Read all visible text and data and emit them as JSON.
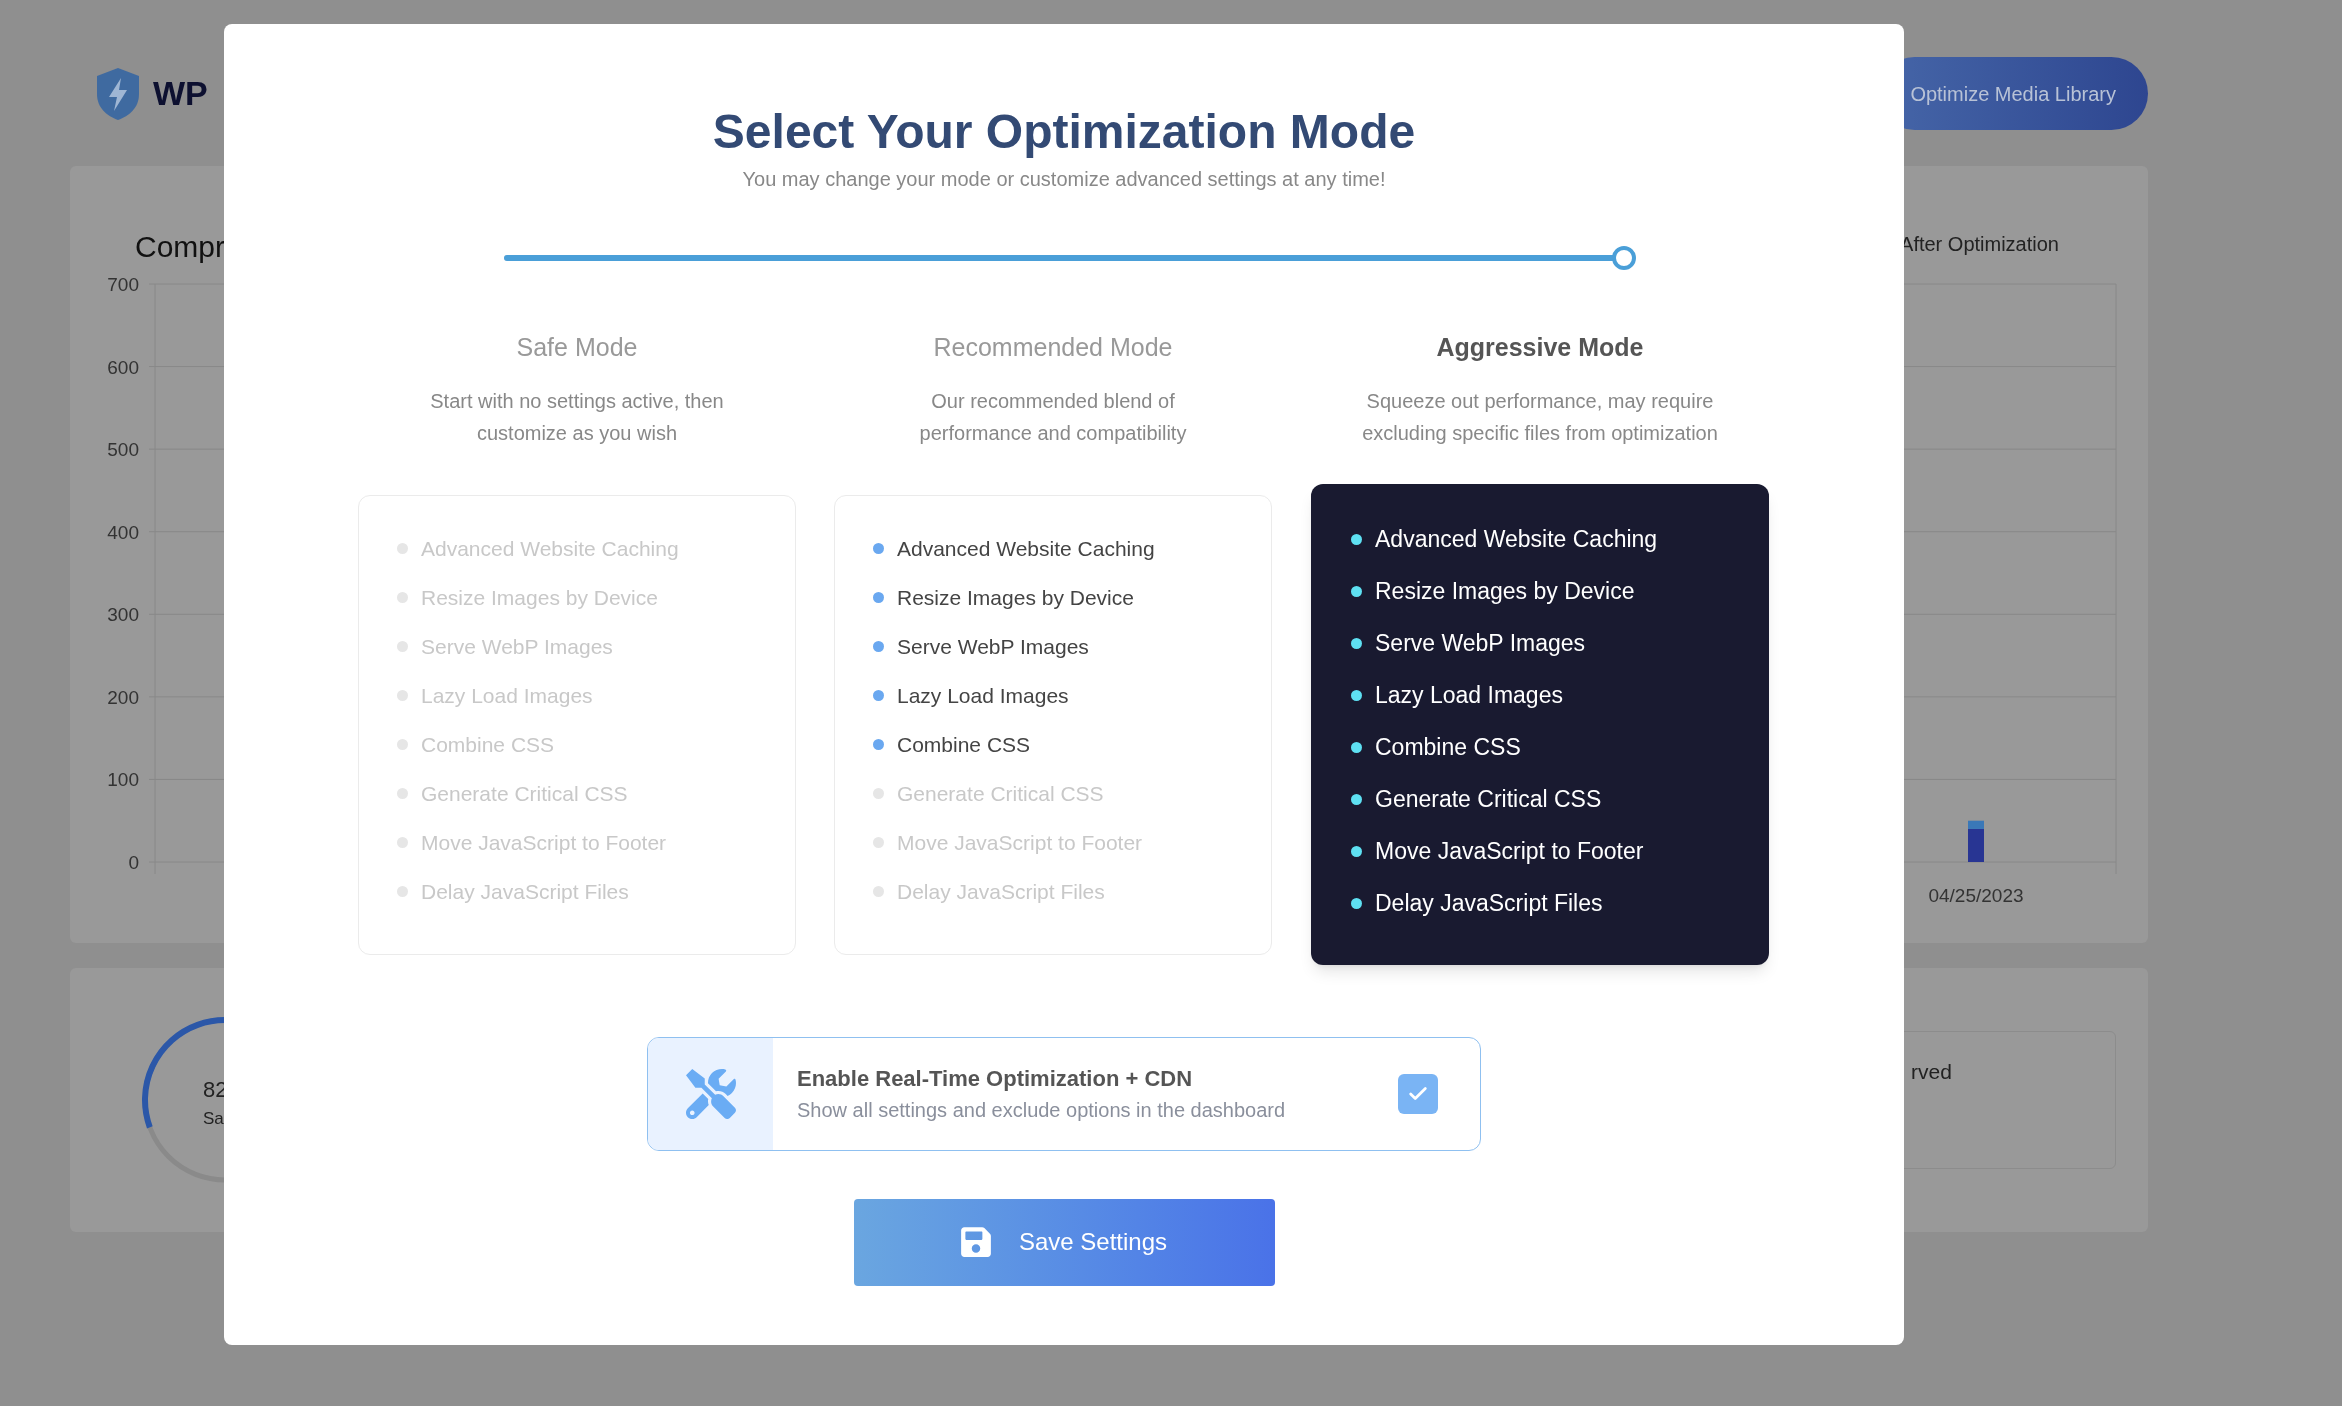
{
  "background": {
    "logo_text": "WP",
    "header_button": "Optimize Media Library",
    "chart_card": {
      "title": "Compr",
      "chart_data": {
        "type": "bar",
        "stacked": true,
        "grid": true,
        "categories": [
          "04/25/2023"
        ],
        "ylim": [
          0,
          700
        ],
        "yticks": [
          0,
          100,
          200,
          300,
          400,
          500,
          600,
          700
        ],
        "series": [
          {
            "name": "After Optimization",
            "color": "#283593",
            "values": [
              40
            ]
          },
          {
            "color": "#3a78b8",
            "values": [
              10
            ]
          }
        ]
      }
    },
    "stats_card": {
      "gauge_value": "82",
      "gauge_label": "Sa",
      "box_text": "rved"
    }
  },
  "modal": {
    "title": "Select Your Optimization Mode",
    "subtitle": "You may change your mode or customize advanced settings at any time!",
    "slider": {
      "level": 1
    },
    "modes": [
      {
        "name": "Safe Mode",
        "description": "Start with no settings active, then customize as you wish",
        "selected": false,
        "features": [
          {
            "label": "Advanced Website Caching",
            "enabled": false
          },
          {
            "label": "Resize Images by Device",
            "enabled": false
          },
          {
            "label": "Serve WebP Images",
            "enabled": false
          },
          {
            "label": "Lazy Load Images",
            "enabled": false
          },
          {
            "label": "Combine CSS",
            "enabled": false
          },
          {
            "label": "Generate Critical CSS",
            "enabled": false
          },
          {
            "label": "Move JavaScript to Footer",
            "enabled": false
          },
          {
            "label": "Delay JavaScript Files",
            "enabled": false
          }
        ]
      },
      {
        "name": "Recommended Mode",
        "description": "Our recommended blend of performance and compatibility",
        "selected": false,
        "features": [
          {
            "label": "Advanced Website Caching",
            "enabled": true
          },
          {
            "label": "Resize Images by Device",
            "enabled": true
          },
          {
            "label": "Serve WebP Images",
            "enabled": true
          },
          {
            "label": "Lazy Load Images",
            "enabled": true
          },
          {
            "label": "Combine CSS",
            "enabled": true
          },
          {
            "label": "Generate Critical CSS",
            "enabled": false
          },
          {
            "label": "Move JavaScript to Footer",
            "enabled": false
          },
          {
            "label": "Delay JavaScript Files",
            "enabled": false
          }
        ]
      },
      {
        "name": "Aggressive Mode",
        "description": "Squeeze out performance, may require excluding specific files from optimization",
        "selected": true,
        "features": [
          {
            "label": "Advanced Website Caching",
            "enabled": true
          },
          {
            "label": "Resize Images by Device",
            "enabled": true
          },
          {
            "label": "Serve WebP Images",
            "enabled": true
          },
          {
            "label": "Lazy Load Images",
            "enabled": true
          },
          {
            "label": "Combine CSS",
            "enabled": true
          },
          {
            "label": "Generate Critical CSS",
            "enabled": true
          },
          {
            "label": "Move JavaScript to Footer",
            "enabled": true
          },
          {
            "label": "Delay JavaScript Files",
            "enabled": true
          }
        ]
      }
    ],
    "cdn_option": {
      "title": "Enable Real-Time Optimization + CDN",
      "description": "Show all settings and exclude options in the dashboard",
      "checked": true
    },
    "save_button": "Save Settings"
  }
}
